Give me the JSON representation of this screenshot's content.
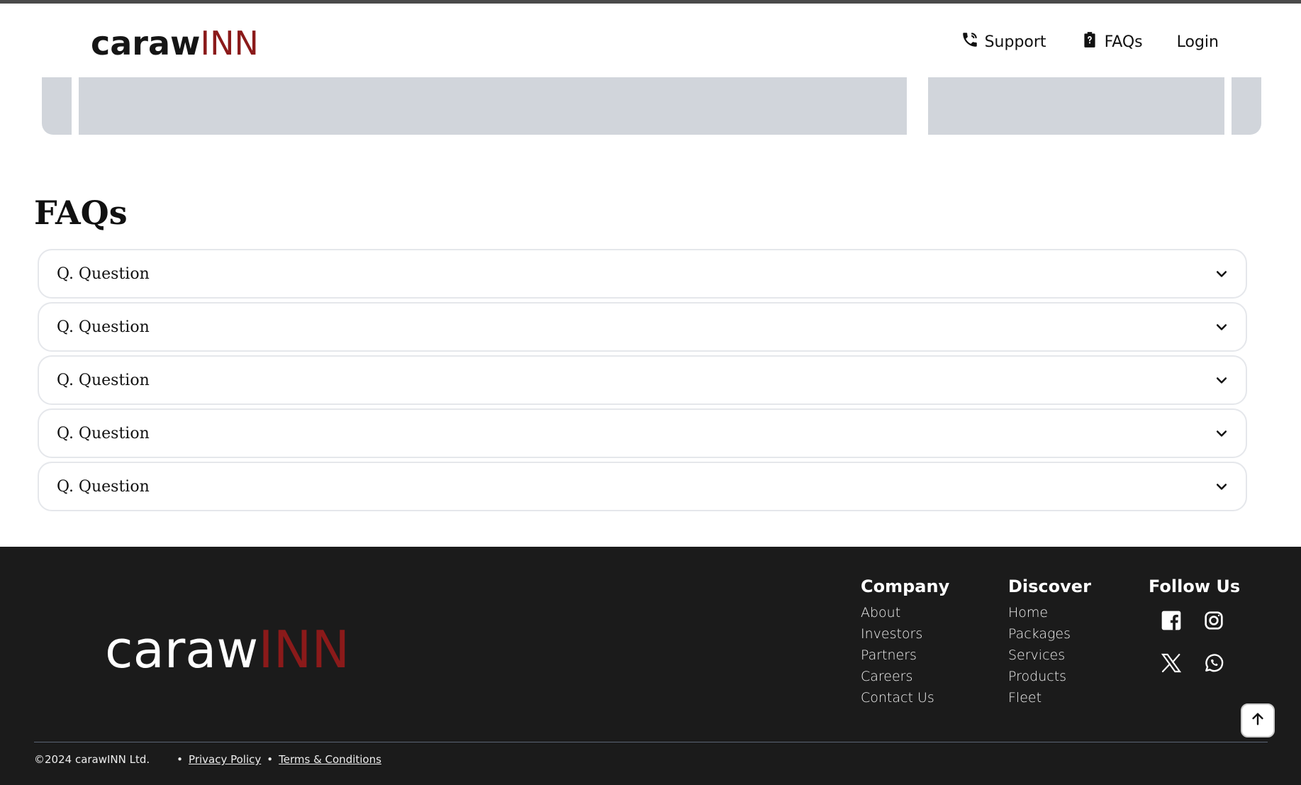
{
  "header": {
    "logo_part1": "caraw",
    "logo_part2": "INN",
    "nav": {
      "support": "Support",
      "faqs": "FAQs",
      "login": "Login"
    }
  },
  "faq": {
    "title": "FAQs",
    "items": [
      {
        "question": "Q. Question"
      },
      {
        "question": "Q. Question"
      },
      {
        "question": "Q. Question"
      },
      {
        "question": "Q. Question"
      },
      {
        "question": "Q. Question"
      }
    ]
  },
  "footer": {
    "logo_part1": "caraw",
    "logo_part2": "INN",
    "company": {
      "heading": "Company",
      "links": [
        "About",
        "Investors",
        "Partners",
        "Careers",
        "Contact Us"
      ]
    },
    "discover": {
      "heading": "Discover",
      "links": [
        "Home",
        "Packages",
        "Services",
        "Products",
        "Fleet"
      ]
    },
    "follow": {
      "heading": "Follow Us",
      "icons": [
        "facebook-icon",
        "instagram-icon",
        "x-twitter-icon",
        "whatsapp-icon"
      ]
    },
    "copyright": "©2024 carawINN Ltd.",
    "privacy": "Privacy Policy",
    "terms": "Terms & Conditions"
  },
  "colors": {
    "brand_red": "#8b1a1a",
    "footer_bg": "#1b1b1b",
    "skeleton": "#d1d5db"
  }
}
